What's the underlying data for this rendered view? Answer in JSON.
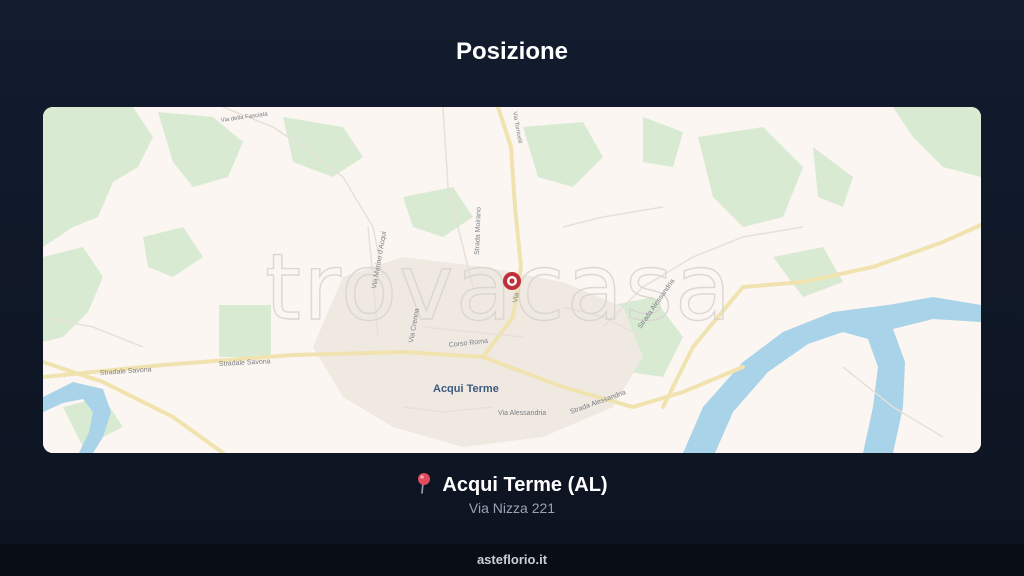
{
  "header": {
    "title": "Posizione"
  },
  "map": {
    "watermark": "trovacasa",
    "city": "Acqui Terme",
    "streets": {
      "stradale_savona_1": "Stradale Savona",
      "stradale_savona_2": "Stradale Savona",
      "corso_roma": "Corso Roma",
      "via_alessandria": "Via Alessandria",
      "strada_alessandria_1": "Strada Alessandria",
      "strada_alessandria_2": "Strada Alessandria",
      "via_crenna": "Via Crenna",
      "via_nizza": "Via",
      "strada_moirano": "Strada Moirano",
      "via_marino": "Via Marino d'Acqui",
      "via_fasciata": "Via della Fasciata",
      "via_torricelli": "Via Torricelli"
    },
    "colors": {
      "land": "#fbf6f1",
      "green": "#d9ead3",
      "water": "#a9d3e8",
      "road": "#f3e7b8",
      "pin": "#c0303a"
    }
  },
  "location": {
    "city_label": "Acqui Terme (AL)",
    "address": "Via Nizza 221",
    "pin_icon": "round-pushpin-icon"
  },
  "footer": {
    "brand": "asteflorio.it"
  }
}
